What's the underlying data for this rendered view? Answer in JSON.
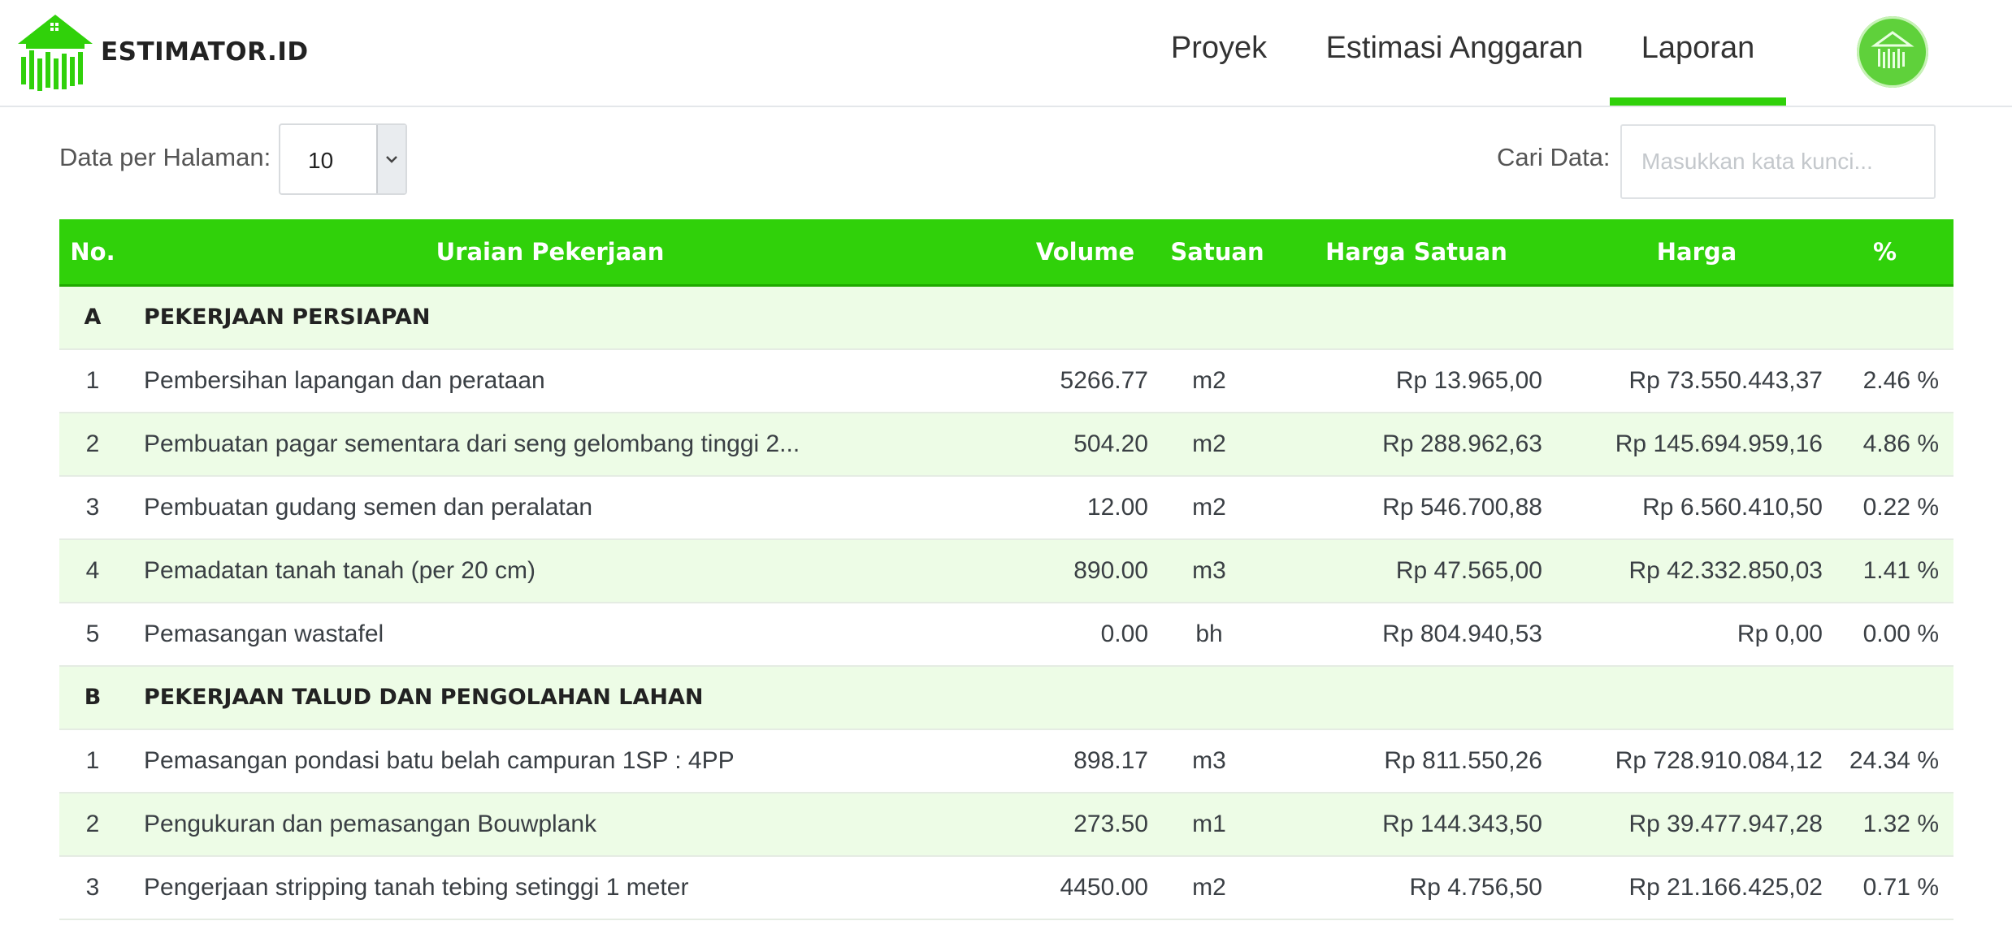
{
  "app": {
    "brand": "ESTIMATOR.ID"
  },
  "nav": {
    "items": [
      "Proyek",
      "Estimasi Anggaran",
      "Laporan"
    ],
    "active": "Laporan"
  },
  "controls": {
    "per_page_label": "Data per Halaman:",
    "per_page_value": "10",
    "search_label": "Cari Data:",
    "search_placeholder": "Masukkan kata kunci..."
  },
  "table": {
    "headers": {
      "no": "No.",
      "desc": "Uraian Pekerjaan",
      "volume": "Volume",
      "satuan": "Satuan",
      "harga_satuan": "Harga Satuan",
      "harga": "Harga",
      "pct": "%"
    },
    "sections": [
      {
        "code": "A",
        "title": "PEKERJAAN PERSIAPAN",
        "rows": [
          {
            "no": "1",
            "desc": "Pembersihan lapangan dan perataan",
            "volume": "5266.77",
            "satuan": "m2",
            "harga_satuan": "Rp 13.965,00",
            "harga": "Rp 73.550.443,37",
            "pct": "2.46 %"
          },
          {
            "no": "2",
            "desc": "Pembuatan pagar sementara dari seng gelombang tinggi 2...",
            "volume": "504.20",
            "satuan": "m2",
            "harga_satuan": "Rp 288.962,63",
            "harga": "Rp 145.694.959,16",
            "pct": "4.86 %"
          },
          {
            "no": "3",
            "desc": "Pembuatan gudang semen dan peralatan",
            "volume": "12.00",
            "satuan": "m2",
            "harga_satuan": "Rp 546.700,88",
            "harga": "Rp 6.560.410,50",
            "pct": "0.22 %"
          },
          {
            "no": "4",
            "desc": "Pemadatan tanah tanah (per 20 cm)",
            "volume": "890.00",
            "satuan": "m3",
            "harga_satuan": "Rp 47.565,00",
            "harga": "Rp 42.332.850,03",
            "pct": "1.41 %"
          },
          {
            "no": "5",
            "desc": "Pemasangan wastafel",
            "volume": "0.00",
            "satuan": "bh",
            "harga_satuan": "Rp 804.940,53",
            "harga": "Rp 0,00",
            "pct": "0.00 %"
          }
        ]
      },
      {
        "code": "B",
        "title": "PEKERJAAN TALUD DAN PENGOLAHAN LAHAN",
        "rows": [
          {
            "no": "1",
            "desc": "Pemasangan pondasi batu belah campuran 1SP : 4PP",
            "volume": "898.17",
            "satuan": "m3",
            "harga_satuan": "Rp 811.550,26",
            "harga": "Rp 728.910.084,12",
            "pct": "24.34 %"
          },
          {
            "no": "2",
            "desc": "Pengukuran dan pemasangan Bouwplank",
            "volume": "273.50",
            "satuan": "m1",
            "harga_satuan": "Rp 144.343,50",
            "harga": "Rp 39.477.947,28",
            "pct": "1.32 %"
          },
          {
            "no": "3",
            "desc": "Pengerjaan stripping tanah tebing setinggi 1 meter",
            "volume": "4450.00",
            "satuan": "m2",
            "harga_satuan": "Rp 4.756,50",
            "harga": "Rp 21.166.425,02",
            "pct": "0.71 %"
          }
        ]
      }
    ]
  },
  "colors": {
    "accent": "#30d10a",
    "row_alt": "#edfce6"
  }
}
